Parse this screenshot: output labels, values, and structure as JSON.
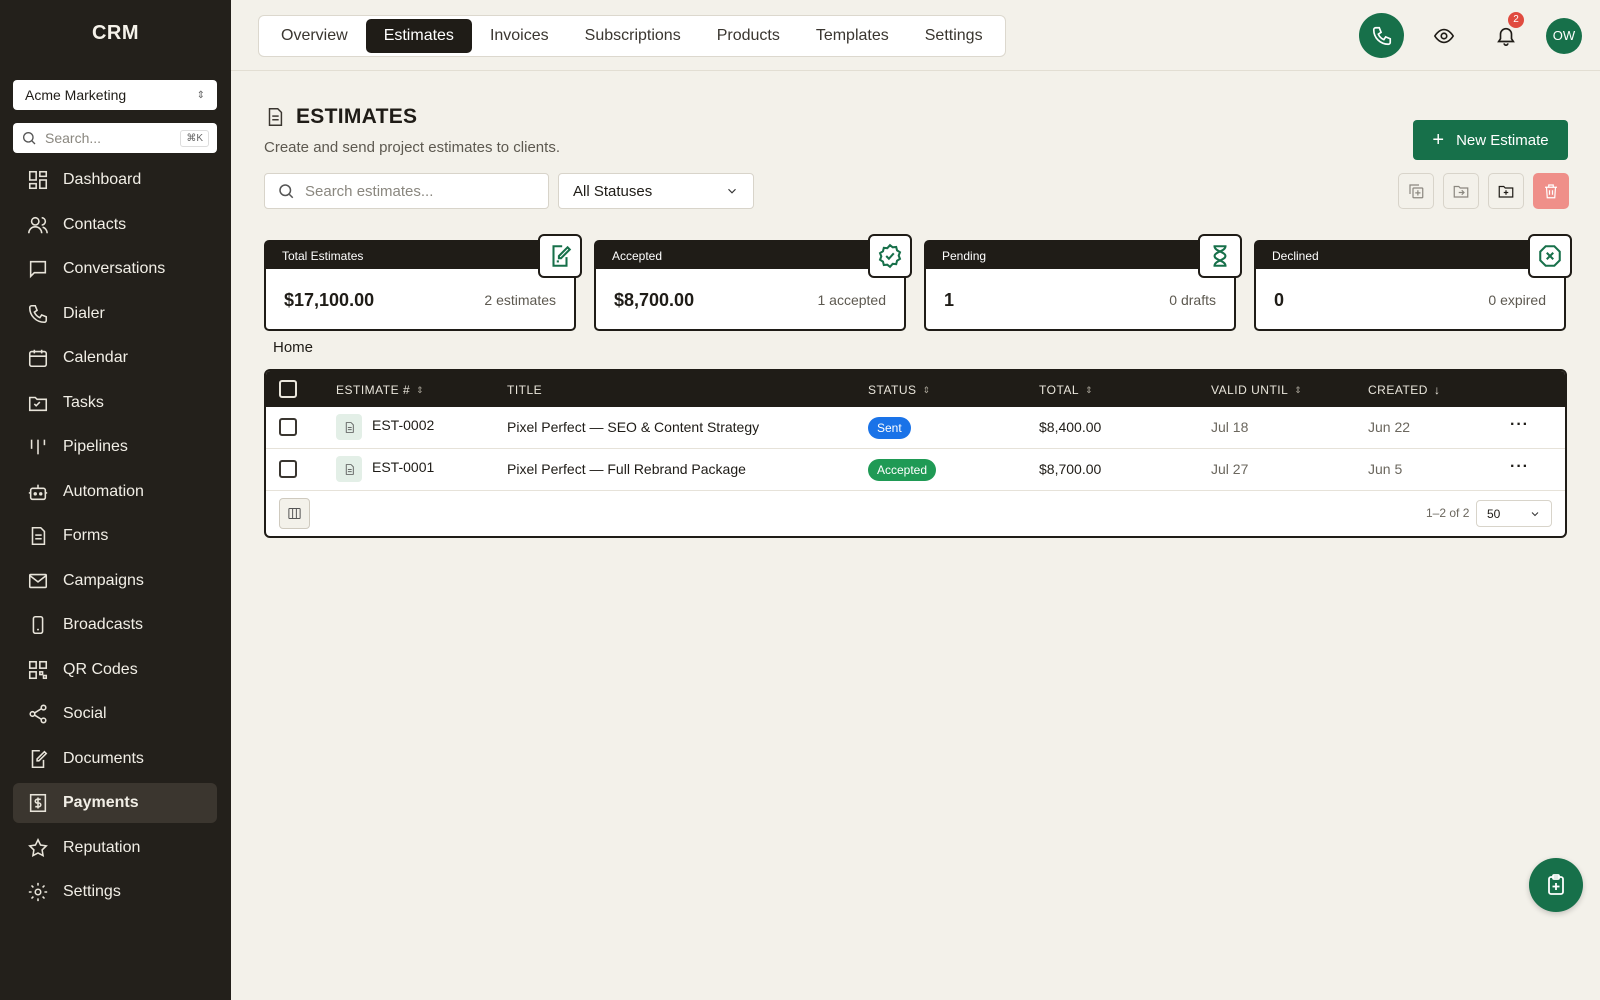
{
  "app": {
    "brand": "CRM"
  },
  "sidebar": {
    "workspace": "Acme Marketing",
    "search_placeholder": "Search...",
    "search_shortcut": "⌘K",
    "items": [
      {
        "label": "Dashboard",
        "icon": "dashboard-icon"
      },
      {
        "label": "Contacts",
        "icon": "users-icon"
      },
      {
        "label": "Conversations",
        "icon": "chat-icon"
      },
      {
        "label": "Dialer",
        "icon": "phone-icon"
      },
      {
        "label": "Calendar",
        "icon": "calendar-icon"
      },
      {
        "label": "Tasks",
        "icon": "folder-icon"
      },
      {
        "label": "Pipelines",
        "icon": "pipeline-icon"
      },
      {
        "label": "Automation",
        "icon": "robot-icon"
      },
      {
        "label": "Forms",
        "icon": "form-icon"
      },
      {
        "label": "Campaigns",
        "icon": "mail-icon"
      },
      {
        "label": "Broadcasts",
        "icon": "mobile-icon"
      },
      {
        "label": "QR Codes",
        "icon": "qr-icon"
      },
      {
        "label": "Social",
        "icon": "share-icon"
      },
      {
        "label": "Documents",
        "icon": "document-edit-icon"
      },
      {
        "label": "Payments",
        "icon": "dollar-icon",
        "active": true
      },
      {
        "label": "Reputation",
        "icon": "star-icon"
      },
      {
        "label": "Settings",
        "icon": "gear-icon"
      }
    ]
  },
  "topbar": {
    "tabs": [
      {
        "label": "Overview"
      },
      {
        "label": "Estimates",
        "active": true
      },
      {
        "label": "Invoices"
      },
      {
        "label": "Subscriptions"
      },
      {
        "label": "Products"
      },
      {
        "label": "Templates"
      },
      {
        "label": "Settings"
      }
    ],
    "notification_count": "2",
    "avatar_initials": "OW"
  },
  "page": {
    "title": "ESTIMATES",
    "subtitle": "Create and send project estimates to clients.",
    "new_button": "New Estimate",
    "search_placeholder": "Search estimates...",
    "status_filter": "All Statuses",
    "breadcrumb": "Home"
  },
  "stats": [
    {
      "label": "Total Estimates",
      "value": "$17,100.00",
      "meta": "2 estimates",
      "icon": "document-edit-icon"
    },
    {
      "label": "Accepted",
      "value": "$8,700.00",
      "meta": "1 accepted",
      "icon": "check-badge-icon"
    },
    {
      "label": "Pending",
      "value": "1",
      "meta": "0 drafts",
      "icon": "hourglass-icon"
    },
    {
      "label": "Declined",
      "value": "0",
      "meta": "0 expired",
      "icon": "x-octagon-icon"
    }
  ],
  "table": {
    "columns": {
      "estimate": "ESTIMATE #",
      "title": "TITLE",
      "status": "STATUS",
      "total": "TOTAL",
      "valid_until": "VALID UNTIL",
      "created": "CREATED"
    },
    "rows": [
      {
        "estimate": "EST-0002",
        "title": "Pixel Perfect — SEO & Content Strategy",
        "status": "Sent",
        "total": "$8,400.00",
        "valid_until": "Jul 18",
        "created": "Jun 22"
      },
      {
        "estimate": "EST-0001",
        "title": "Pixel Perfect — Full Rebrand Package",
        "status": "Accepted",
        "total": "$8,700.00",
        "valid_until": "Jul 27",
        "created": "Jun 5"
      }
    ],
    "pagination": "1–2 of 2",
    "page_size": "50"
  },
  "colors": {
    "accent": "#17704a",
    "sidebar": "#23201b",
    "sent": "#1a73e8",
    "accepted": "#1f9a55",
    "danger": "#ef8f89"
  }
}
